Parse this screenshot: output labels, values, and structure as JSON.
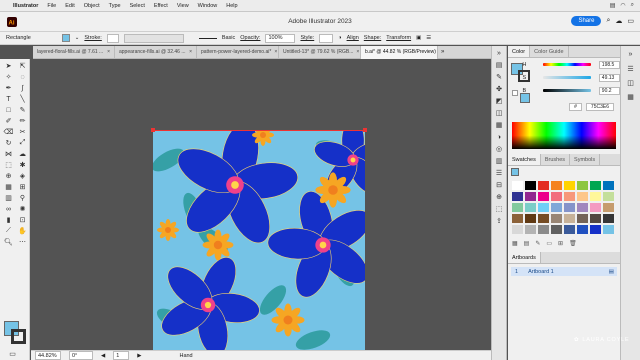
{
  "menu": {
    "app": "Illustrator",
    "items": [
      "File",
      "Edit",
      "Object",
      "Type",
      "Select",
      "Effect",
      "View",
      "Window",
      "Help"
    ]
  },
  "window": {
    "title": "Adobe Illustrator 2023",
    "share": "Share"
  },
  "control": {
    "selection": "Rectangle",
    "stroke_label": "Stroke:",
    "brush": "Basic",
    "opacity_label": "Opacity:",
    "opacity": "100%",
    "style_label": "Style:",
    "align": "Align",
    "shape": "Shape:",
    "transform": "Transform"
  },
  "tabs": [
    {
      "label": "layered-floral-fills.ai @ 7.61 ..."
    },
    {
      "label": "appearance-fills.ai @ 32.46 ..."
    },
    {
      "label": "pattern-power-layered-demo.ai*"
    },
    {
      "label": "Untitled-13* @ 79.62 % (RGB..."
    },
    {
      "label": "b.ai* @ 44.82 % (RGB/Preview)"
    }
  ],
  "status": {
    "zoom": "44.82%",
    "rotate": "0°",
    "page": "1",
    "tool": "Hand"
  },
  "color_panel": {
    "tabs": [
      "Color",
      "Color Guide"
    ],
    "sliders": [
      {
        "label": "H",
        "value": "198.5"
      },
      {
        "label": "S",
        "value": "49.13"
      },
      {
        "label": "B",
        "value": "90.2"
      }
    ],
    "hex": "75C3E6"
  },
  "swatches_panel": {
    "tabs": [
      "Swatches",
      "Brushes",
      "Symbols"
    ]
  },
  "artboards_panel": {
    "title": "Artboards",
    "rows": [
      {
        "num": "1",
        "name": "Artboard 1"
      }
    ]
  },
  "watermark": "LAURA COYLE",
  "colors": {
    "fill": "#75c3e6",
    "accent": "#1473e6",
    "petal": "#1530c8",
    "leaf": "#2a9a9a",
    "flower": "#f6a623"
  },
  "swatches": [
    "#ffffff",
    "#000000",
    "#e32d22",
    "#f5821f",
    "#ffd400",
    "#8dc63f",
    "#00a651",
    "#0072bc",
    "#2e3192",
    "#92278f",
    "#ec008c",
    "#f26d7d",
    "#f7977a",
    "#fdc68a",
    "#fff79a",
    "#c4df9b",
    "#82ca9d",
    "#7bcdc8",
    "#6ecff6",
    "#7ea7d8",
    "#8493ca",
    "#a187be",
    "#f49ac1",
    "#c69c6d",
    "#8c6239",
    "#603913",
    "#754c24",
    "#998675",
    "#c7b299",
    "#736357",
    "#534741",
    "#363636",
    "#d8d8d8",
    "#b3b3b3",
    "#8a8a8a",
    "#606060",
    "#3a5a9a",
    "#2050c0",
    "#1530c8",
    "#75c3e6"
  ]
}
